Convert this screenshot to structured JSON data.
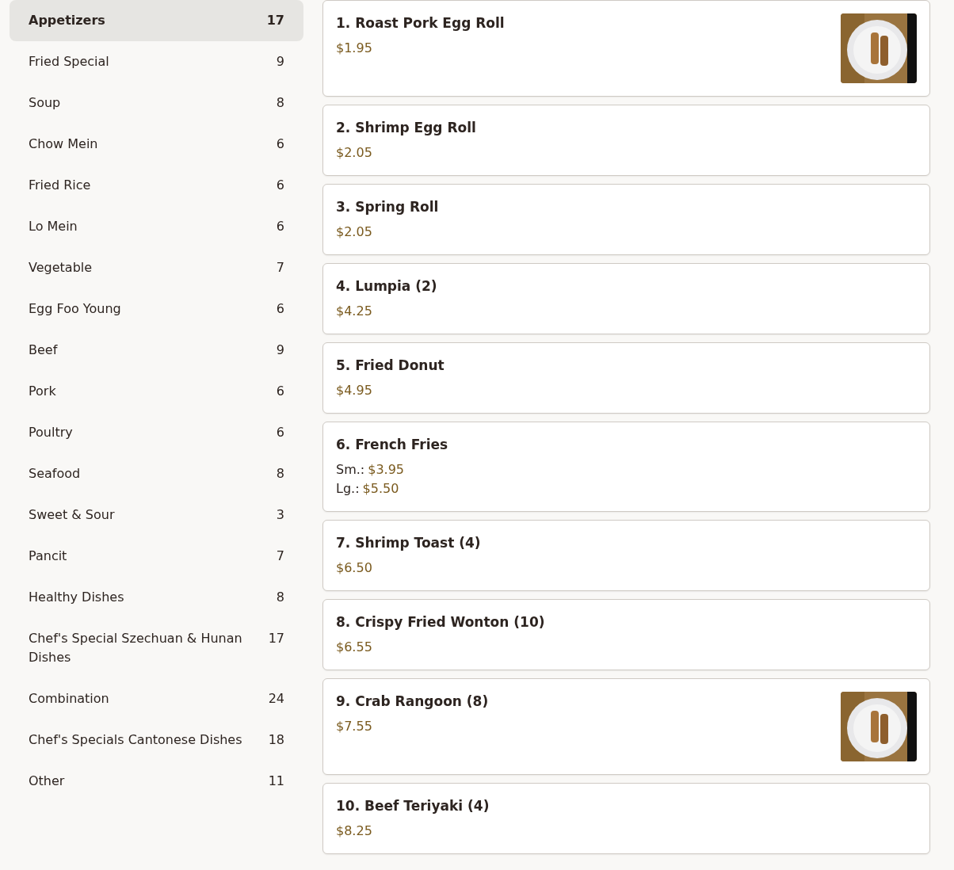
{
  "categories": [
    {
      "name": "Appetizers",
      "count": "17",
      "selected": true
    },
    {
      "name": "Fried Special",
      "count": "9",
      "selected": false
    },
    {
      "name": "Soup",
      "count": "8",
      "selected": false
    },
    {
      "name": "Chow Mein",
      "count": "6",
      "selected": false
    },
    {
      "name": "Fried Rice",
      "count": "6",
      "selected": false
    },
    {
      "name": "Lo Mein",
      "count": "6",
      "selected": false
    },
    {
      "name": "Vegetable",
      "count": "7",
      "selected": false
    },
    {
      "name": "Egg Foo Young",
      "count": "6",
      "selected": false
    },
    {
      "name": "Beef",
      "count": "9",
      "selected": false
    },
    {
      "name": "Pork",
      "count": "6",
      "selected": false
    },
    {
      "name": "Poultry",
      "count": "6",
      "selected": false
    },
    {
      "name": "Seafood",
      "count": "8",
      "selected": false
    },
    {
      "name": "Sweet & Sour",
      "count": "3",
      "selected": false
    },
    {
      "name": "Pancit",
      "count": "7",
      "selected": false
    },
    {
      "name": "Healthy Dishes",
      "count": "8",
      "selected": false
    },
    {
      "name": "Chef's Special Szechuan & Hunan Dishes",
      "count": "17",
      "selected": false
    },
    {
      "name": "Combination",
      "count": "24",
      "selected": false
    },
    {
      "name": "Chef's Specials Cantonese Dishes",
      "count": "18",
      "selected": false
    },
    {
      "name": "Other",
      "count": "11",
      "selected": false
    }
  ],
  "items": [
    {
      "name": "1. Roast Pork Egg Roll",
      "prices": [
        {
          "price": "$1.95"
        }
      ],
      "photo": {
        "kind": "picture"
      }
    },
    {
      "name": "2. Shrimp Egg Roll",
      "prices": [
        {
          "price": "$2.05"
        }
      ]
    },
    {
      "name": "3. Spring Roll",
      "prices": [
        {
          "price": "$2.05"
        }
      ]
    },
    {
      "name": "4. Lumpia (2)",
      "prices": [
        {
          "price": "$4.25"
        }
      ]
    },
    {
      "name": "5. Fried Donut",
      "prices": [
        {
          "price": "$4.95"
        }
      ]
    },
    {
      "name": "6. French Fries",
      "prices": [
        {
          "label": "Sm.:",
          "price": "$3.95"
        },
        {
          "label": "Lg.:",
          "price": "$5.50"
        }
      ]
    },
    {
      "name": "7. Shrimp Toast (4)",
      "prices": [
        {
          "price": "$6.50"
        }
      ]
    },
    {
      "name": "8. Crispy Fried Wonton (10)",
      "prices": [
        {
          "price": "$6.55"
        }
      ]
    },
    {
      "name": "9. Crab Rangoon (8)",
      "prices": [
        {
          "price": "$7.55"
        }
      ],
      "photo": {
        "kind": "picture"
      }
    },
    {
      "name": "10. Beef Teriyaki (4)",
      "prices": [
        {
          "price": "$8.25"
        }
      ]
    }
  ]
}
